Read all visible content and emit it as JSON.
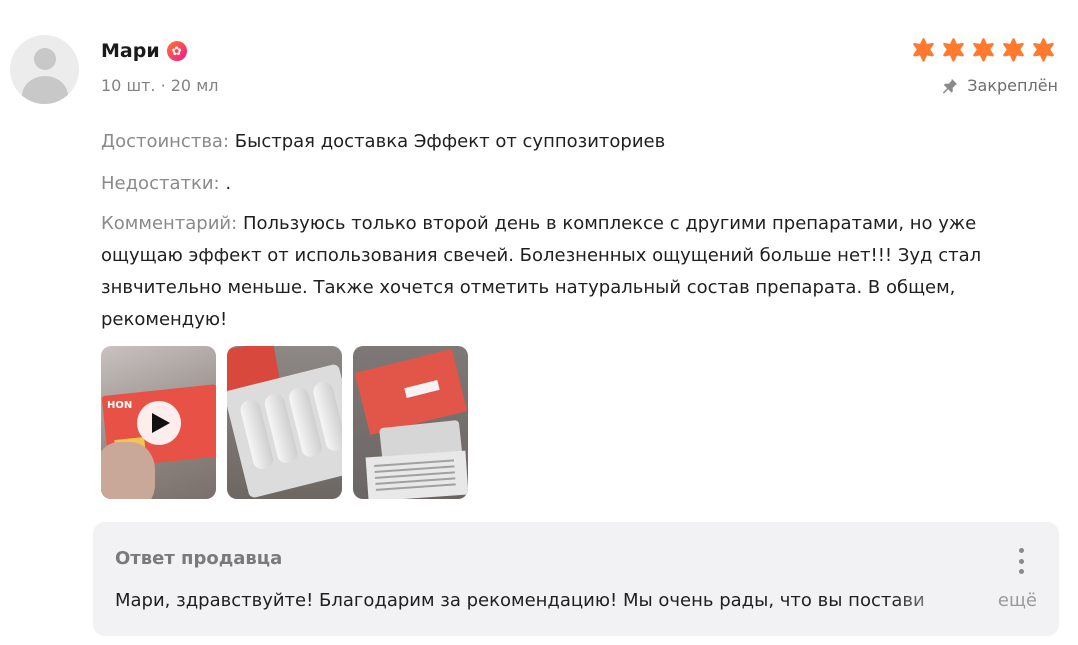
{
  "review": {
    "author": "Мари",
    "variant": "10 шт. · 20 мл",
    "rating": 5,
    "rating_max": 5,
    "pinned_label": "Закреплён",
    "pros_label": "Достоинства:",
    "pros_text": "Быстрая доставка Эффект от суппозиториев",
    "cons_label": "Недостатки:",
    "cons_text": ".",
    "comment_label": "Комментарий:",
    "comment_text": "Пользуюсь только второй день в комплексе с другими препаратами, но уже ощущаю эффект от использования свечей. Болезненных ощущений больше нет!!! Зуд стал знвчительно меньше. Также хочется отметить натуральный состав препарата. В общем, рекомендую!",
    "photos": [
      {
        "kind": "video",
        "caption": "HON"
      },
      {
        "kind": "image"
      },
      {
        "kind": "image"
      }
    ]
  },
  "seller_reply": {
    "title": "Ответ продавца",
    "text": "Мари, здравствуйте! Благодарим за рекомендацию! Мы очень рады, что вы постави",
    "more_label": "ещё"
  },
  "icons": {
    "avatar": "user-avatar-placeholder",
    "badge": "flower-badge-icon",
    "star": "star-icon",
    "pin": "pin-icon",
    "play": "play-icon",
    "menu": "kebab-menu-icon"
  },
  "colors": {
    "star": "#ff7a2f",
    "badge_from": "#ff7a2f",
    "badge_to": "#f2148a",
    "label_gray": "#8a8a8a",
    "reply_bg": "#f2f2f4"
  }
}
